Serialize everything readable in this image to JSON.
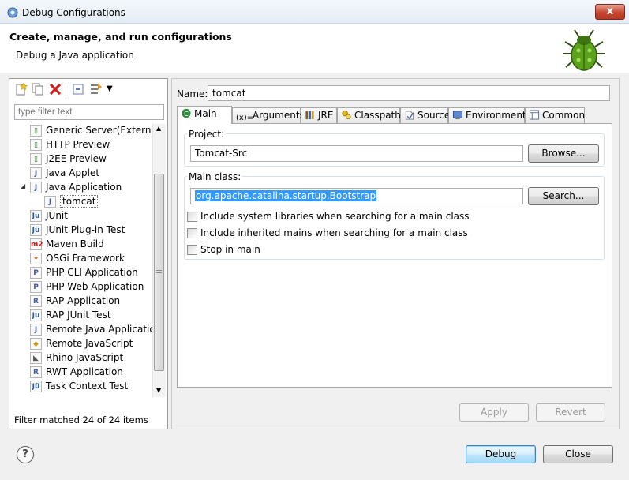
{
  "window": {
    "title": "Debug Configurations",
    "close_glyph": "x"
  },
  "header": {
    "title": "Create, manage, and run configurations",
    "subtitle": "Debug a Java application"
  },
  "left": {
    "toolbar_icons": [
      "new-config-icon",
      "duplicate-icon",
      "delete-icon",
      "collapse-all-icon",
      "filter-icon",
      "view-menu-icon"
    ],
    "filter_placeholder": "type filter text",
    "tree": [
      {
        "label": "Generic Server(External La",
        "icon": "server-icon",
        "glyph": "▯",
        "color": "#3a7a3a",
        "indent": 1
      },
      {
        "label": "HTTP Preview",
        "icon": "server-icon",
        "glyph": "▯",
        "color": "#3a7a3a",
        "indent": 1
      },
      {
        "label": "J2EE Preview",
        "icon": "server-icon",
        "glyph": "▯",
        "color": "#3a7a3a",
        "indent": 1
      },
      {
        "label": "Java Applet",
        "icon": "applet-icon",
        "glyph": "J",
        "color": "#3b5fa8",
        "indent": 1
      },
      {
        "label": "Java Application",
        "icon": "java-app-icon",
        "glyph": "J",
        "color": "#3b5fa8",
        "indent": 1,
        "expander": "◢"
      },
      {
        "label": "tomcat",
        "icon": "java-launch-icon",
        "glyph": "J",
        "color": "#3b5fa8",
        "indent": 2,
        "selected": true
      },
      {
        "label": "JUnit",
        "icon": "junit-icon",
        "glyph": "Ju",
        "color": "#2a5d9a",
        "indent": 1
      },
      {
        "label": "JUnit Plug-in Test",
        "icon": "junit-plugin-icon",
        "glyph": "Jü",
        "color": "#2a5d9a",
        "indent": 1
      },
      {
        "label": "Maven Build",
        "icon": "maven-icon",
        "glyph": "m2",
        "color": "#c0201b",
        "indent": 1
      },
      {
        "label": "OSGi Framework",
        "icon": "osgi-icon",
        "glyph": "✦",
        "color": "#c87a2a",
        "indent": 1
      },
      {
        "label": "PHP CLI Application",
        "icon": "php-cli-icon",
        "glyph": "P",
        "color": "#4a5aa0",
        "indent": 1
      },
      {
        "label": "PHP Web Application",
        "icon": "php-web-icon",
        "glyph": "P",
        "color": "#4a5aa0",
        "indent": 1
      },
      {
        "label": "RAP Application",
        "icon": "rap-icon",
        "glyph": "R",
        "color": "#3b5fa8",
        "indent": 1
      },
      {
        "label": "RAP JUnit Test",
        "icon": "rap-junit-icon",
        "glyph": "Ju",
        "color": "#2a5d9a",
        "indent": 1
      },
      {
        "label": "Remote Java Application",
        "icon": "remote-java-icon",
        "glyph": "J",
        "color": "#3b5fa8",
        "indent": 1
      },
      {
        "label": "Remote JavaScript",
        "icon": "remote-js-icon",
        "glyph": "◆",
        "color": "#c8a020",
        "indent": 1
      },
      {
        "label": "Rhino JavaScript",
        "icon": "rhino-icon",
        "glyph": "◣",
        "color": "#555555",
        "indent": 1
      },
      {
        "label": "RWT Application",
        "icon": "rwt-icon",
        "glyph": "R",
        "color": "#3b5fa8",
        "indent": 1
      },
      {
        "label": "Task Context Test",
        "icon": "task-context-icon",
        "glyph": "Jü",
        "color": "#2a5d9a",
        "indent": 1
      }
    ],
    "filter_status": "Filter matched 24 of 24 items"
  },
  "right": {
    "name_label": "Name:",
    "name_value": "tomcat",
    "tabs": [
      {
        "label": "Main",
        "icon": "main-tab-icon",
        "active": true
      },
      {
        "label": "Arguments",
        "icon": "arguments-tab-icon"
      },
      {
        "label": "JRE",
        "icon": "jre-tab-icon"
      },
      {
        "label": "Classpath",
        "icon": "classpath-tab-icon"
      },
      {
        "label": "Source",
        "icon": "source-tab-icon"
      },
      {
        "label": "Environment",
        "icon": "environment-tab-icon"
      },
      {
        "label": "Common",
        "icon": "common-tab-icon"
      }
    ],
    "project_label": "Project:",
    "project_value": "Tomcat-Src",
    "browse_label": "Browse...",
    "main_class_label": "Main class:",
    "main_class_value": "org.apache.catalina.startup.Bootstrap",
    "search_label": "Search...",
    "options": [
      {
        "label": "Include system libraries when searching for a main class",
        "checked": false
      },
      {
        "label": "Include inherited mains when searching for a main class",
        "checked": false
      },
      {
        "label": "Stop in main",
        "checked": false
      }
    ],
    "apply_label": "Apply",
    "revert_label": "Revert"
  },
  "footer": {
    "help_glyph": "?",
    "debug_label": "Debug",
    "close_label": "Close"
  }
}
